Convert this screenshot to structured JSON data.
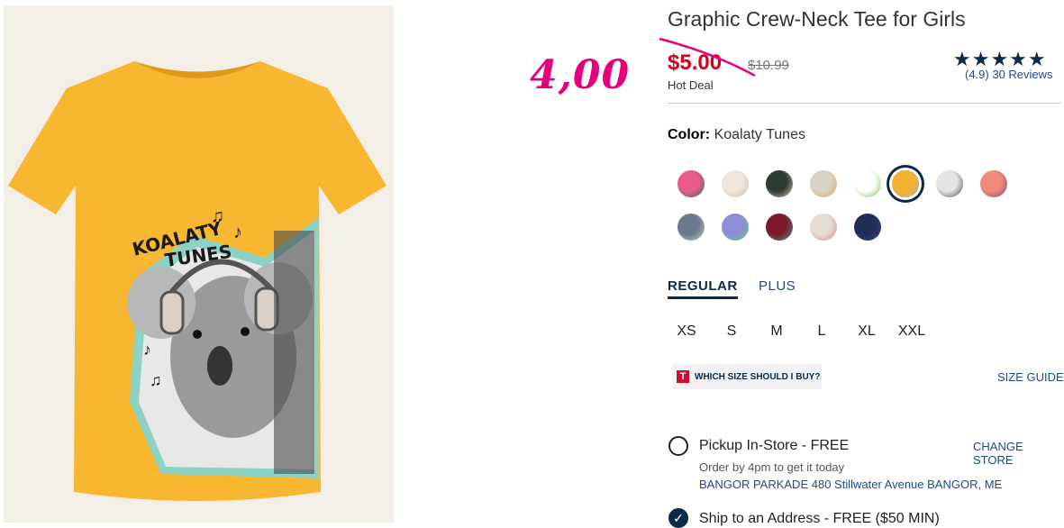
{
  "annotation": {
    "handwritten_price": "4,00",
    "color": "#e6007e"
  },
  "product": {
    "title": "Graphic Crew-Neck Tee for Girls",
    "sale_price": "$5.00",
    "original_price": "$10.99",
    "deal_label": "Hot Deal",
    "rating": {
      "stars": "★★★★★",
      "text": "(4.9) 30 Reviews"
    },
    "image": {
      "graphic_text_line1": "KOALATY",
      "graphic_text_line2": "TUNES",
      "shirt_color": "#f7b731"
    }
  },
  "color": {
    "label": "Color:",
    "value": "Koalaty Tunes",
    "swatches": [
      {
        "name": "swatch-1",
        "colors": [
          "#e85b8a",
          "#3a6b5a"
        ]
      },
      {
        "name": "swatch-2",
        "colors": [
          "#efe6dc",
          "#c9b8a8"
        ]
      },
      {
        "name": "swatch-3",
        "colors": [
          "#2f3a33",
          "#d8c7b0"
        ]
      },
      {
        "name": "swatch-4",
        "colors": [
          "#d8d2c8",
          "#e0a75a"
        ]
      },
      {
        "name": "swatch-5",
        "colors": [
          "#ffffff",
          "#7cc04b"
        ]
      },
      {
        "name": "swatch-koalaty-tunes",
        "colors": [
          "#f2b230",
          "#b0b0b0"
        ],
        "selected": true
      },
      {
        "name": "swatch-7",
        "colors": [
          "#e4e4e4",
          "#4a4a4a"
        ]
      },
      {
        "name": "swatch-8",
        "colors": [
          "#f08a7a",
          "#7a4a8c"
        ]
      },
      {
        "name": "swatch-9",
        "colors": [
          "#6a7a8c",
          "#c9ccd3"
        ]
      },
      {
        "name": "swatch-10",
        "colors": [
          "#8c8cd8",
          "#6ad07a"
        ]
      },
      {
        "name": "swatch-11",
        "colors": [
          "#7a1a2a",
          "#3aa0a0"
        ]
      },
      {
        "name": "swatch-12",
        "colors": [
          "#e6ddd2",
          "#d08a8a"
        ]
      },
      {
        "name": "swatch-13",
        "colors": [
          "#1e2d5a",
          "#3a4a7a"
        ]
      }
    ]
  },
  "fit": {
    "tabs": [
      "REGULAR",
      "PLUS"
    ],
    "active": "REGULAR"
  },
  "sizes": [
    "XS",
    "S",
    "M",
    "L",
    "XL",
    "XXL"
  ],
  "size_help": {
    "badge": "T",
    "which_size": "WHICH SIZE SHOULD I BUY?",
    "size_guide": "SIZE GUIDE"
  },
  "fulfillment": {
    "pickup_label": "Pickup In-Store - FREE",
    "change_store": "CHANGE STORE",
    "order_by": "Order by 4pm to get it today",
    "store_address": "BANGOR PARKADE 480 Stillwater Avenue  BANGOR, ME",
    "ship_label": "Ship to an Address - FREE ($50 MIN)"
  },
  "colors": {
    "accent": "#0b2a4a",
    "sale": "#d0021b",
    "link": "#1d4a8c"
  }
}
